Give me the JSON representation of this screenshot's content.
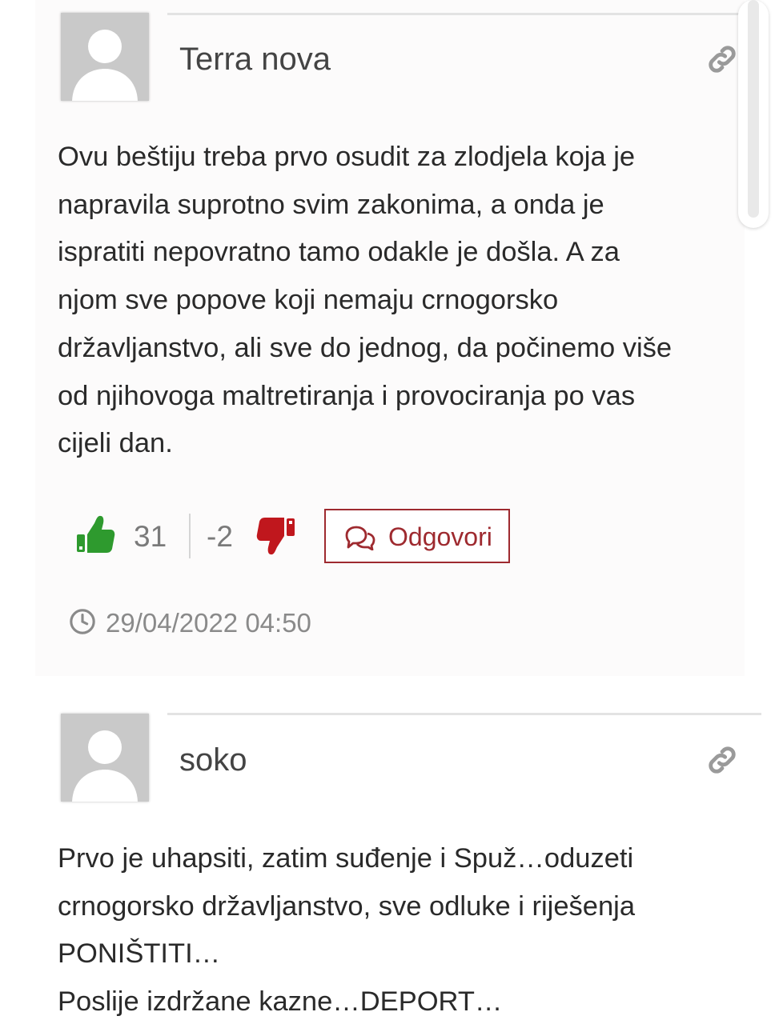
{
  "comments": [
    {
      "author": "Terra nova",
      "text_lines": [
        "Ovu beštiju treba prvo osudit za zlodjela koja je",
        "napravila suprotno svim zakonima, a onda je",
        "ispratiti nepovratno tamo odakle je došla. A za",
        "njom sve popove koji nemaju crnogorsko",
        "državljanstvo, ali sve do jednog, da počinemo više",
        "od njihovoga maltretiranja i provociranja po vas",
        "cijeli dan."
      ],
      "likes": "31",
      "dislikes": "-2",
      "reply_label": "Odgovori",
      "timestamp": "29/04/2022 04:50",
      "icons": {
        "avatar": "default-avatar-icon",
        "permalink": "link-icon",
        "like": "thumbs-up-icon",
        "dislike": "thumbs-down-icon",
        "reply": "chat-bubbles-icon",
        "time": "clock-icon"
      }
    },
    {
      "author": "soko",
      "text_lines": [
        "Prvo je uhapsiti, zatim suđenje i Spuž…oduzeti",
        "crnogorsko državljanstvo, sve odluke i riješenja",
        "PONIŠTITI…",
        "Poslije izdržane kazne…DEPORT…"
      ],
      "icons": {
        "avatar": "default-avatar-icon",
        "permalink": "link-icon"
      }
    }
  ],
  "colors": {
    "accent": "#9e2a2f",
    "like_green": "#2e9a2e",
    "dislike_red": "#c0171d",
    "text": "#2a2a2a",
    "muted": "#8a8a8a"
  }
}
